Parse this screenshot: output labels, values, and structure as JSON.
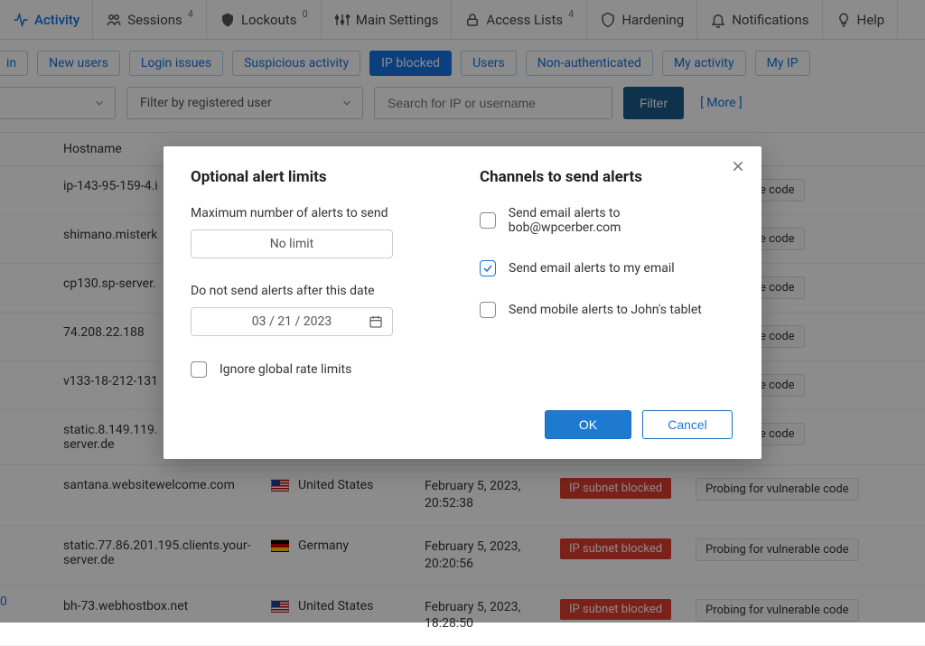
{
  "topnav": {
    "activity": "Activity",
    "sessions": "Sessions",
    "sessions_count": "4",
    "lockouts": "Lockouts",
    "lockouts_count": "0",
    "main_settings": "Main Settings",
    "access_lists": "Access Lists",
    "access_lists_count": "4",
    "hardening": "Hardening",
    "notifications": "Notifications",
    "help": "Help"
  },
  "chips": {
    "partial_in": "in",
    "new_users": "New users",
    "login_issues": "Login issues",
    "suspicious": "Suspicious activity",
    "ip_blocked": "IP blocked",
    "users": "Users",
    "non_auth": "Non-authenticated",
    "my_activity": "My activity",
    "my_ip": "My IP"
  },
  "filters": {
    "reg_user_placeholder": "Filter by registered user",
    "search_placeholder": "Search for IP or username",
    "filter_btn": "Filter",
    "more": "[ More ]"
  },
  "table": {
    "head_hostname": "Hostname",
    "rows": [
      {
        "host": "ip-143-95-159-4.i",
        "flag": "",
        "country": "",
        "date": "",
        "badge": "",
        "event": "r vulnerable code"
      },
      {
        "host": "shimano.misterk",
        "flag": "",
        "country": "",
        "date": "",
        "badge": "",
        "event": "r vulnerable code"
      },
      {
        "host": "cp130.sp-server.",
        "flag": "",
        "country": "",
        "date": "",
        "badge": "",
        "event": "r vulnerable code"
      },
      {
        "host": "74.208.22.188",
        "flag": "",
        "country": "",
        "date": "",
        "badge": "",
        "event": "r vulnerable code"
      },
      {
        "host": "v133-18-212-131",
        "flag": "",
        "country": "",
        "date": "",
        "badge": "",
        "event": "r vulnerable code"
      },
      {
        "host": "static.8.149.119.\nserver.de",
        "flag": "",
        "country": "",
        "date": "",
        "badge": "",
        "event": "r vulnerable code"
      },
      {
        "host": "santana.websitewelcome.com",
        "flag": "us",
        "country": "United States",
        "date": "February 5, 2023,\n20:52:38",
        "badge": "IP subnet blocked",
        "event": "Probing for vulnerable code"
      },
      {
        "host": "static.77.86.201.195.clients.your-\nserver.de",
        "flag": "de",
        "country": "Germany",
        "date": "February 5, 2023,\n20:20:56",
        "badge": "IP subnet blocked",
        "event": "Probing for vulnerable code"
      },
      {
        "host": "bh-73.webhostbox.net",
        "flag": "us",
        "country": "United States",
        "date": "February 5, 2023,\n18:28:50",
        "badge": "IP subnet blocked",
        "event": "Probing for vulnerable code"
      }
    ]
  },
  "leftnum": "0",
  "modal": {
    "left_heading": "Optional alert limits",
    "max_alerts_label": "Maximum number of alerts to send",
    "no_limit_value": "No limit",
    "date_label": "Do not send alerts after this date",
    "date_value": "03 / 21 / 2023",
    "ignore_rate": "Ignore global rate limits",
    "right_heading": "Channels to send alerts",
    "ch_email_bob": "Send email alerts to bob@wpcerber.com",
    "ch_email_my": "Send email alerts to my email",
    "ch_mobile": "Send mobile alerts to John's tablet",
    "ok": "OK",
    "cancel": "Cancel"
  }
}
